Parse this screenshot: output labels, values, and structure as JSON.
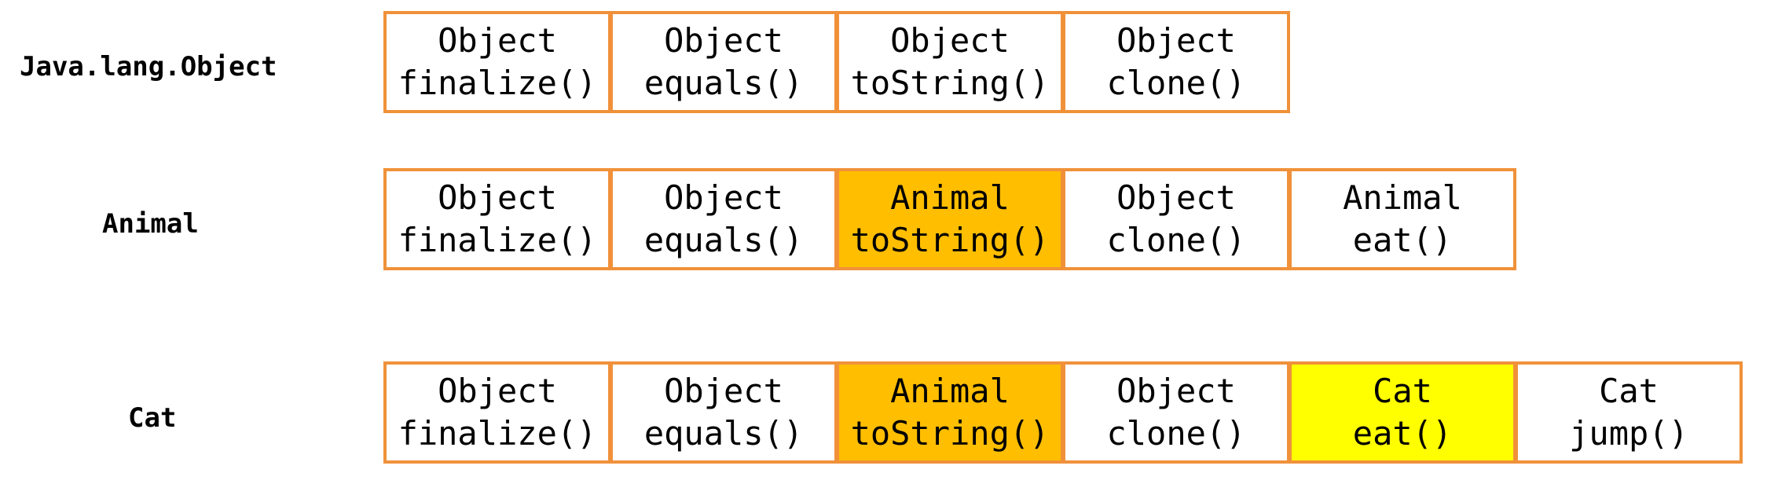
{
  "colors": {
    "border": "#f0913a",
    "default_fill": "#ffffff",
    "animal_override_fill": "#ffbe00",
    "cat_override_fill": "#ffff00"
  },
  "rows": [
    {
      "label": "Java.lang.Object",
      "cells": [
        {
          "owner": "Object",
          "method": "finalize()",
          "fill": "#ffffff"
        },
        {
          "owner": "Object",
          "method": "equals()",
          "fill": "#ffffff"
        },
        {
          "owner": "Object",
          "method": "toString()",
          "fill": "#ffffff"
        },
        {
          "owner": "Object",
          "method": "clone()",
          "fill": "#ffffff"
        }
      ]
    },
    {
      "label": "Animal",
      "cells": [
        {
          "owner": "Object",
          "method": "finalize()",
          "fill": "#ffffff"
        },
        {
          "owner": "Object",
          "method": "equals()",
          "fill": "#ffffff"
        },
        {
          "owner": "Animal",
          "method": "toString()",
          "fill": "#ffbe00"
        },
        {
          "owner": "Object",
          "method": "clone()",
          "fill": "#ffffff"
        },
        {
          "owner": "Animal",
          "method": "eat()",
          "fill": "#ffffff"
        }
      ]
    },
    {
      "label": "Cat",
      "cells": [
        {
          "owner": "Object",
          "method": "finalize()",
          "fill": "#ffffff"
        },
        {
          "owner": "Object",
          "method": "equals()",
          "fill": "#ffffff"
        },
        {
          "owner": "Animal",
          "method": "toString()",
          "fill": "#ffbe00"
        },
        {
          "owner": "Object",
          "method": "clone()",
          "fill": "#ffffff"
        },
        {
          "owner": "Cat",
          "method": "eat()",
          "fill": "#ffff00"
        },
        {
          "owner": "Cat",
          "method": "jump()",
          "fill": "#ffffff"
        }
      ]
    }
  ]
}
